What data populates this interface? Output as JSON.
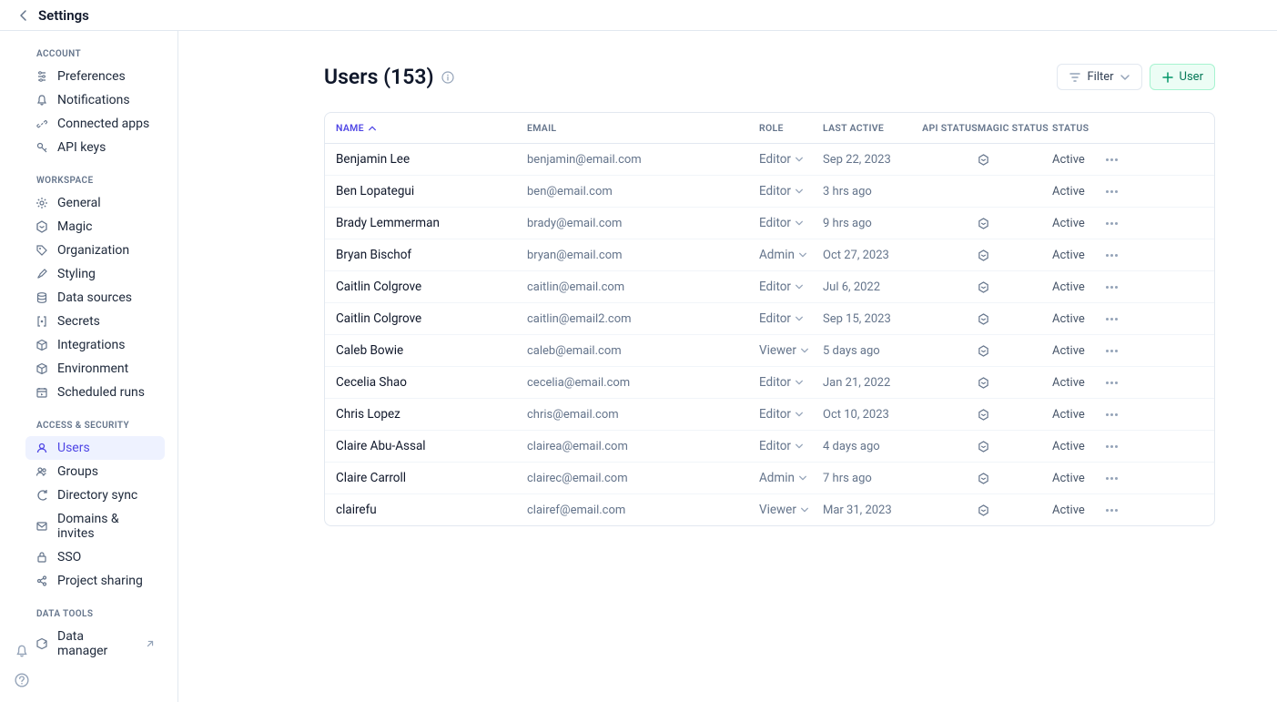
{
  "header": {
    "title": "Settings"
  },
  "sidebar": {
    "sections": [
      {
        "label": "ACCOUNT",
        "items": [
          {
            "label": "Preferences",
            "icon": "sliders-icon"
          },
          {
            "label": "Notifications",
            "icon": "bell-icon"
          },
          {
            "label": "Connected apps",
            "icon": "link-icon"
          },
          {
            "label": "API keys",
            "icon": "key-icon"
          }
        ]
      },
      {
        "label": "WORKSPACE",
        "items": [
          {
            "label": "General",
            "icon": "gear-icon"
          },
          {
            "label": "Magic",
            "icon": "hex-icon"
          },
          {
            "label": "Organization",
            "icon": "tag-icon"
          },
          {
            "label": "Styling",
            "icon": "brush-icon"
          },
          {
            "label": "Data sources",
            "icon": "database-icon"
          },
          {
            "label": "Secrets",
            "icon": "brackets-icon"
          },
          {
            "label": "Integrations",
            "icon": "package-icon"
          },
          {
            "label": "Environment",
            "icon": "cube-icon"
          },
          {
            "label": "Scheduled runs",
            "icon": "calendar-play-icon"
          }
        ]
      },
      {
        "label": "ACCESS & SECURITY",
        "items": [
          {
            "label": "Users",
            "icon": "user-icon",
            "active": true
          },
          {
            "label": "Groups",
            "icon": "users-icon"
          },
          {
            "label": "Directory sync",
            "icon": "refresh-icon"
          },
          {
            "label": "Domains & invites",
            "icon": "mail-icon"
          },
          {
            "label": "SSO",
            "icon": "lock-icon"
          },
          {
            "label": "Project sharing",
            "icon": "share-icon"
          }
        ]
      },
      {
        "label": "DATA TOOLS",
        "items": [
          {
            "label": "Data manager",
            "icon": "data-manager-icon",
            "external": true
          }
        ]
      }
    ]
  },
  "page": {
    "title": "Users (153)",
    "filter_label": "Filter",
    "add_label": "User"
  },
  "table": {
    "headers": {
      "name": "NAME",
      "email": "EMAIL",
      "role": "ROLE",
      "last_active": "LAST ACTIVE",
      "api_status": "API STATUS",
      "magic_status": "MAGIC STATUS",
      "status": "STATUS"
    },
    "rows": [
      {
        "name": "Benjamin Lee",
        "email": "benjamin@email.com",
        "role": "Editor",
        "last_active": "Sep 22, 2023",
        "magic": true,
        "status": "Active"
      },
      {
        "name": "Ben Lopategui",
        "email": "ben@email.com",
        "role": "Editor",
        "last_active": "3 hrs ago",
        "magic": false,
        "status": "Active"
      },
      {
        "name": "Brady Lemmerman",
        "email": "brady@email.com",
        "role": "Editor",
        "last_active": "9 hrs ago",
        "magic": true,
        "status": "Active"
      },
      {
        "name": "Bryan Bischof",
        "email": "bryan@email.com",
        "role": "Admin",
        "last_active": "Oct 27, 2023",
        "magic": true,
        "status": "Active"
      },
      {
        "name": "Caitlin Colgrove",
        "email": "caitlin@email.com",
        "role": "Editor",
        "last_active": "Jul 6, 2022",
        "magic": true,
        "status": "Active"
      },
      {
        "name": "Caitlin Colgrove",
        "email": "caitlin@email2.com",
        "role": "Editor",
        "last_active": "Sep 15, 2023",
        "magic": true,
        "status": "Active"
      },
      {
        "name": "Caleb Bowie",
        "email": "caleb@email.com",
        "role": "Viewer",
        "last_active": "5 days ago",
        "magic": true,
        "status": "Active"
      },
      {
        "name": "Cecelia Shao",
        "email": "cecelia@email.com",
        "role": "Editor",
        "last_active": "Jan 21, 2022",
        "magic": true,
        "status": "Active"
      },
      {
        "name": "Chris Lopez",
        "email": "chris@email.com",
        "role": "Editor",
        "last_active": "Oct 10, 2023",
        "magic": true,
        "status": "Active"
      },
      {
        "name": "Claire Abu-Assal",
        "email": "clairea@email.com",
        "role": "Editor",
        "last_active": "4 days ago",
        "magic": true,
        "status": "Active"
      },
      {
        "name": "Claire Carroll",
        "email": "clairec@email.com",
        "role": "Admin",
        "last_active": "7 hrs ago",
        "magic": true,
        "status": "Active"
      },
      {
        "name": "clairefu",
        "email": "clairef@email.com",
        "role": "Viewer",
        "last_active": "Mar 31, 2023",
        "magic": true,
        "status": "Active"
      }
    ]
  }
}
